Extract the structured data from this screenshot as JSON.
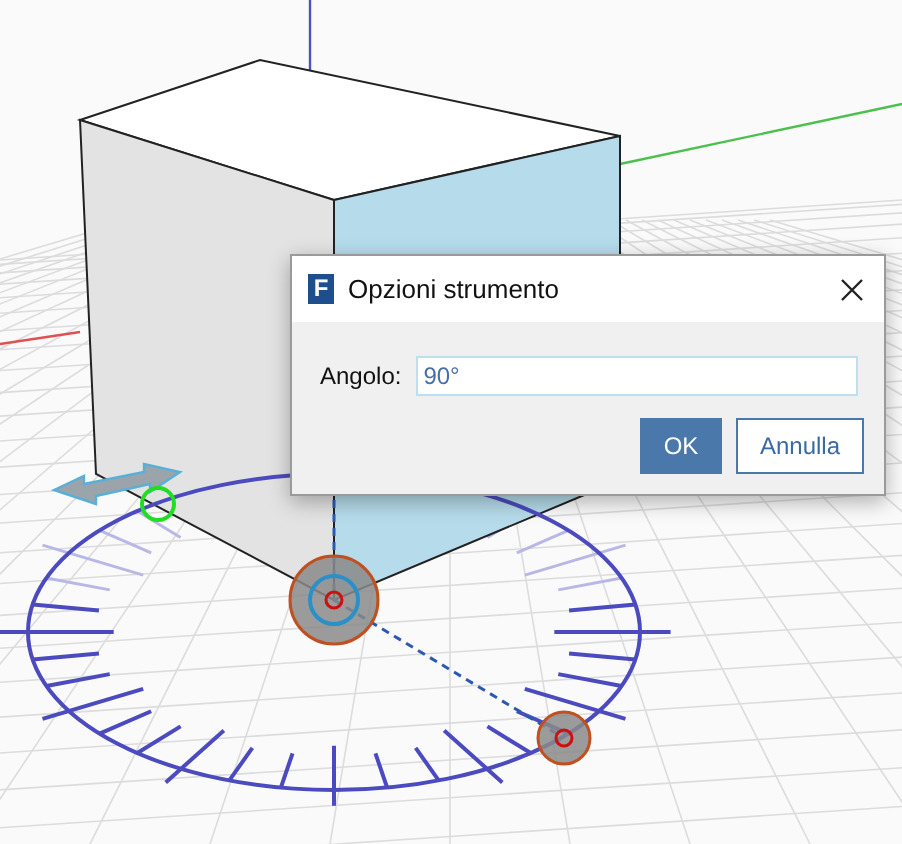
{
  "dialog": {
    "app_icon_letter": "F",
    "title": "Opzioni strumento",
    "field": {
      "label": "Angolo:",
      "value": "90°"
    },
    "buttons": [
      {
        "label": "OK",
        "kind": "primary"
      },
      {
        "label": "Annulla",
        "kind": "secondary"
      }
    ]
  }
}
